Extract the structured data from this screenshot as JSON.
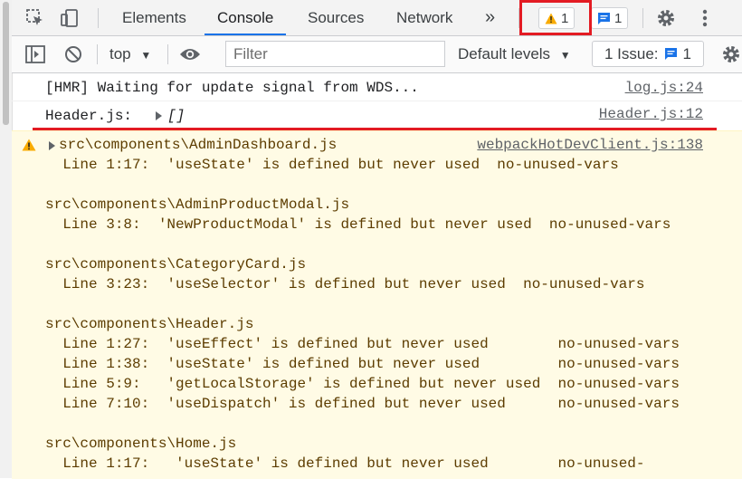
{
  "tabs": [
    {
      "label": "Elements",
      "active": false
    },
    {
      "label": "Console",
      "active": true
    },
    {
      "label": "Sources",
      "active": false
    },
    {
      "label": "Network",
      "active": false
    }
  ],
  "more_tabs": "»",
  "warning_badge": {
    "count": "1"
  },
  "message_badge": {
    "count": "1"
  },
  "toolbar": {
    "context": "top",
    "filter_placeholder": "Filter",
    "levels": "Default levels",
    "issues_label": "1 Issue:",
    "issues_count": "1"
  },
  "logs": [
    {
      "text": "[HMR] Waiting for update signal from WDS...",
      "source": "log.js:24"
    },
    {
      "text": "Header.js:",
      "expand": "[]",
      "source": "Header.js:12"
    }
  ],
  "warning": {
    "source": "webpackHotDevClient.js:138",
    "lines": [
      "src\\components\\AdminDashboard.js",
      "  Line 1:17:  'useState' is defined but never used  no-unused-vars",
      "",
      "src\\components\\AdminProductModal.js",
      "  Line 3:8:  'NewProductModal' is defined but never used  no-unused-vars",
      "",
      "src\\components\\CategoryCard.js",
      "  Line 3:23:  'useSelector' is defined but never used  no-unused-vars",
      "",
      "src\\components\\Header.js",
      "  Line 1:27:  'useEffect' is defined but never used        no-unused-vars",
      "  Line 1:38:  'useState' is defined but never used         no-unused-vars",
      "  Line 5:9:   'getLocalStorage' is defined but never used  no-unused-vars",
      "  Line 7:10:  'useDispatch' is defined but never used      no-unused-vars",
      "",
      "src\\components\\Home.js",
      "  Line 1:17:   'useState' is defined but never used        no-unused-"
    ]
  },
  "colors": {
    "accent": "#1a73e8",
    "warning": "#f9ab00",
    "highlight": "#e31b23"
  }
}
